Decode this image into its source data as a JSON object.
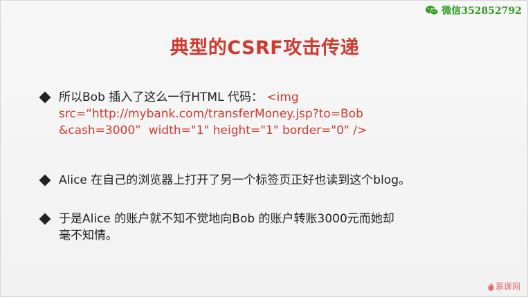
{
  "watermark": {
    "text": "微信352852792",
    "icon": "wechat-icon"
  },
  "title": "典型的CSRF攻击传递",
  "bullets": [
    {
      "prefix": "所以Bob 插入了这么一行HTML 代码：",
      "code_line1": "<img",
      "code_line2": "src=“http://mybank.com/transferMoney.jsp?to=Bob",
      "code_line3": "&cash=3000”  width=\"1\" height=\"1\" border=\"0\" />"
    },
    {
      "text": "Alice 在自己的浏览器上打开了另一个标签页正好也读到这个blog。"
    },
    {
      "line1": "于是Alice 的账户就不知不觉地向Bob 的账户转账3000元而她却",
      "line2": "毫不知情。"
    }
  ],
  "logo": {
    "text": "慕课网",
    "icon": "flame-icon"
  }
}
